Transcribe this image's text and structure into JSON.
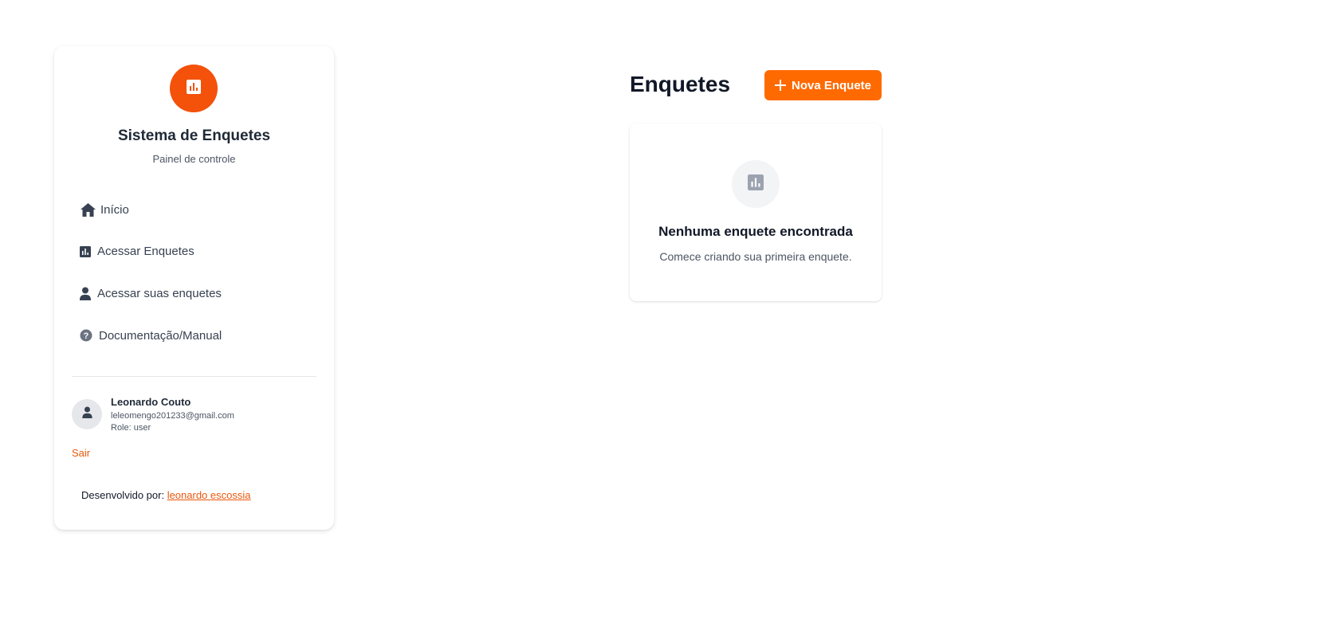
{
  "sidebar": {
    "brand_icon": "bar-chart-icon",
    "title": "Sistema de Enquetes",
    "subtitle": "Painel de controle",
    "nav": [
      {
        "label": "Início",
        "icon": "home-icon"
      },
      {
        "label": "Acessar Enquetes",
        "icon": "bar-chart-icon"
      },
      {
        "label": "Acessar suas enquetes",
        "icon": "user-icon"
      },
      {
        "label": "Documentação/Manual",
        "icon": "help-circle-icon"
      }
    ],
    "user": {
      "name": "Leonardo Couto",
      "email": "leleomengo201233@gmail.com",
      "role": "Role: user"
    },
    "logout_label": "Sair",
    "footer": {
      "prefix": "Desenvolvido por:",
      "link_label": "leonardo escossia"
    }
  },
  "main": {
    "title": "Enquetes",
    "new_button_label": "Nova Enquete",
    "empty_state": {
      "title": "Nenhuma enquete encontrada",
      "subtitle": "Comece criando sua primeira enquete."
    }
  },
  "colors": {
    "brand_orange": "#f4510b",
    "button_orange": "#ff6a00",
    "link_orange": "#ea580c"
  }
}
